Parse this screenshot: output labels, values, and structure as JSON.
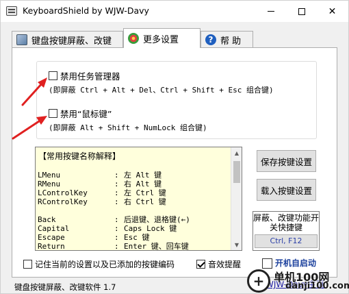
{
  "window": {
    "title": "KeyboardShield by WJW-Davy",
    "minimize_glyph": "—",
    "close_glyph": "✕"
  },
  "tabs": [
    {
      "label": "键盘按键屏蔽、改键",
      "icon": "keyboard-icon"
    },
    {
      "label": "更多设置",
      "icon": "settings-globe-icon",
      "active": true
    },
    {
      "label": "帮 助",
      "icon": "help-icon",
      "icon_glyph": "?"
    }
  ],
  "options": {
    "disable_task_manager": {
      "label": "禁用任务管理器",
      "checked": false,
      "note": "(即屏蔽 Ctrl + Alt + Del、Ctrl + Shift + Esc 组合键)"
    },
    "disable_mouse_keys": {
      "label": "禁用“鼠标键”",
      "checked": false,
      "note": "(即屏蔽 Alt + Shift + NumLock 组合键)"
    }
  },
  "key_names": {
    "header": "【常用按键名称解释】",
    "rows": [
      {
        "key": "LMenu",
        "sep": ":",
        "desc": "左 Alt 键"
      },
      {
        "key": "RMenu",
        "sep": ":",
        "desc": "右 Alt 键"
      },
      {
        "key": "LControlKey",
        "sep": ":",
        "desc": "左 Ctrl 键"
      },
      {
        "key": "RControlKey",
        "sep": ":",
        "desc": "右 Ctrl 键"
      },
      {
        "key": "Back",
        "sep": ":",
        "desc": "后退键、退格键(←)"
      },
      {
        "key": "Capital",
        "sep": ":",
        "desc": "Caps Lock 键"
      },
      {
        "key": "Escape",
        "sep": ":",
        "desc": "Esc 键"
      },
      {
        "key": "Return",
        "sep": ":",
        "desc": "Enter 键、回车键"
      }
    ]
  },
  "buttons": {
    "save_settings": "保存按键设置",
    "load_settings": "载入按键设置"
  },
  "hotkey": {
    "title": "屏蔽、改键功能开关快捷键",
    "value": "Ctrl, F12"
  },
  "bottom": {
    "remember": {
      "label": "记住当前的设置以及已添加的按键编码",
      "checked": false
    },
    "sound": {
      "label": "音效提醒",
      "checked": true
    },
    "startup": {
      "label": "开机自启动",
      "checked": false
    },
    "homepage": "WJW-Davy主页"
  },
  "status_bar": "键盘按键屏蔽、改键软件 1.7",
  "watermark": {
    "text": "单机100网",
    "url": "danji100.com",
    "glyph": "+"
  },
  "colors": {
    "listbox_bg": "#ffffdc",
    "arrow": "#e02020",
    "startup_text": "#1a3f9c",
    "hotkey_text": "#2a3ea8"
  }
}
